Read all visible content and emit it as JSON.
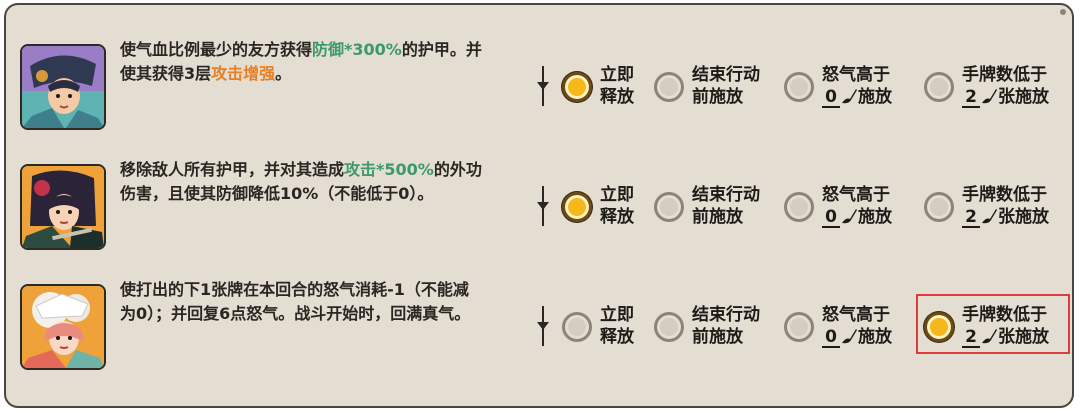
{
  "skills": [
    {
      "desc_line1_a": "使气血比例最少的友方获得",
      "desc_line1_hl": "防御*300%",
      "desc_line1_b": "的护甲。并",
      "desc_line2_a": "使其获得3层",
      "desc_line2_hl": "攻击增强",
      "desc_line2_b": "。",
      "selected": "immediate"
    },
    {
      "desc_line1_a": "移除敌人所有护甲，并对其造成",
      "desc_line1_hl": "攻击*500%",
      "desc_line1_b": "的外功",
      "desc_line2_a": "伤害，且使其防御降低10%（不能低于0）。",
      "desc_line2_hl": "",
      "desc_line2_b": "",
      "selected": "immediate"
    },
    {
      "desc_line1_a": "使打出的下1张牌在本回合的怒气消耗-1（不能减",
      "desc_line1_hl": "",
      "desc_line1_b": "",
      "desc_line2_a": "为0）；并回复6点怒气。战斗开始时，回满真气。",
      "desc_line2_hl": "",
      "desc_line2_b": "",
      "selected": "hand_below"
    }
  ],
  "options": {
    "immediate": {
      "line1": "立即",
      "line2": "释放"
    },
    "before_end": {
      "line1": "结束行动",
      "line2": "前施放"
    },
    "rage_above": {
      "line1": "怒气高于",
      "value": "0",
      "suffix": "施放"
    },
    "hand_below": {
      "line1": "手牌数低于",
      "value": "2",
      "suffix": "张施放"
    }
  },
  "colors": {
    "panel_bg": "#e3ddd2",
    "highlight_green": "#3c9a6a",
    "highlight_orange": "#e87f22",
    "radio_on": "#f5b71a",
    "selection_box": "#e03a3a"
  }
}
